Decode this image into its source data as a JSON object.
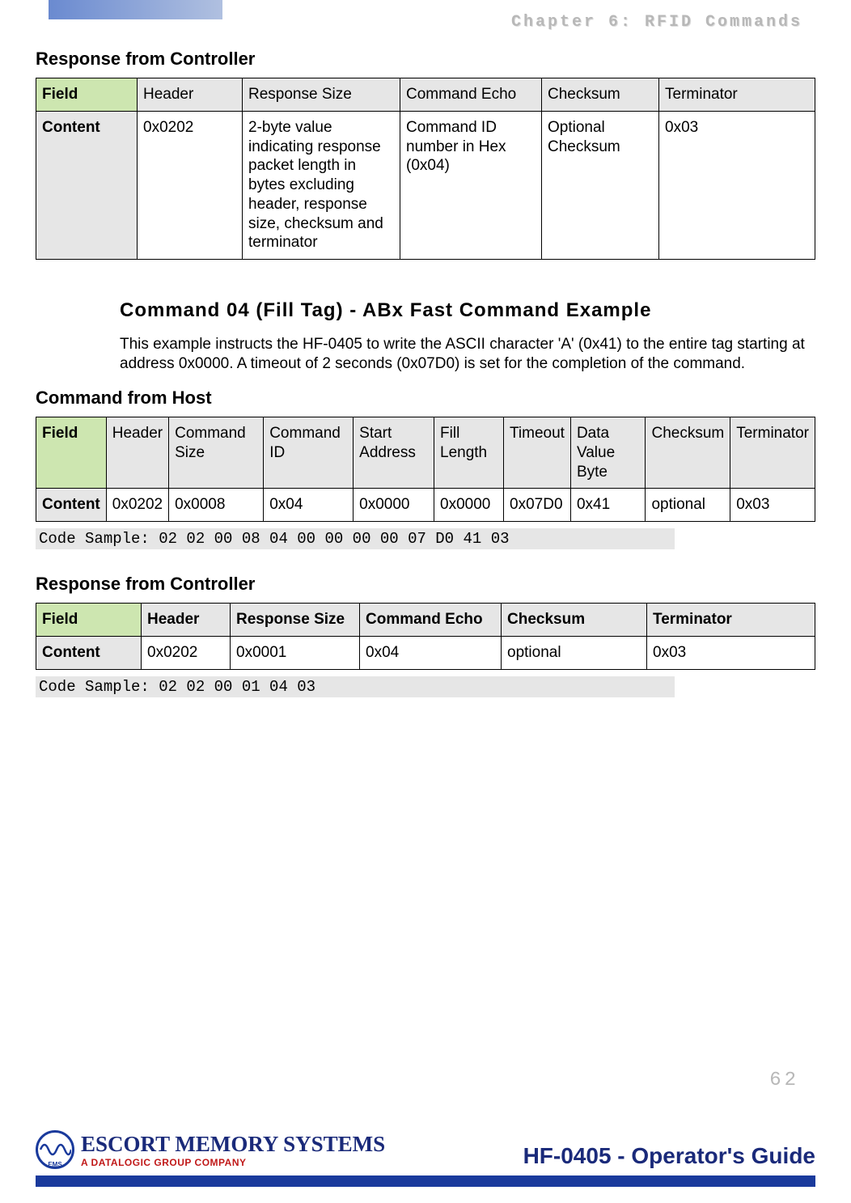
{
  "chapter": "Chapter 6: RFID Commands",
  "page_number": "62",
  "sections": {
    "resp1_heading": "Response from Controller",
    "cmd_heading": "Command 04 (Fill Tag) - ABx Fast Command Example",
    "cmd_body": "This example instructs the HF-0405 to write the ASCII character 'A' (0x41) to the entire tag starting at address 0x0000. A timeout of 2 seconds (0x07D0) is set for the completion of the command.",
    "host_heading": "Command from Host",
    "resp2_heading": "Response from Controller"
  },
  "table1": {
    "row1": [
      "Field",
      "Header",
      "Response Size",
      "Command Echo",
      "Checksum",
      "Terminator"
    ],
    "row2": [
      "Content",
      "0x0202",
      "2-byte value indicating response packet length in bytes excluding header, response size, checksum and terminator",
      "Command ID number in Hex (0x04)",
      "Optional Checksum",
      "0x03"
    ]
  },
  "table2": {
    "row1": [
      "Field",
      "Header",
      "Command Size",
      "Command ID",
      "Start Address",
      "Fill Length",
      "Timeout",
      "Data Value Byte",
      "Checksum",
      "Terminator"
    ],
    "row2": [
      "Content",
      "0x0202",
      "0x0008",
      "0x04",
      "0x0000",
      "0x0000",
      "0x07D0",
      "0x41",
      "optional",
      "0x03"
    ]
  },
  "code_sample_1": "Code Sample: 02 02 00 08 04 00 00 00 00 07 D0 41 03",
  "table3": {
    "row1": [
      "Field",
      "Header",
      "Response Size",
      "Command Echo",
      "Checksum",
      "Terminator"
    ],
    "row2": [
      "Content",
      "0x0202",
      "0x0001",
      "0x04",
      "optional",
      "0x03"
    ]
  },
  "code_sample_2": "Code Sample: 02 02 00 01 04 03",
  "footer": {
    "logo_main": "ESCORT MEMORY SYSTEMS",
    "logo_sub": "A DATALOGIC GROUP COMPANY",
    "guide": "HF-0405 - Operator's Guide",
    "ems": "EMS"
  }
}
